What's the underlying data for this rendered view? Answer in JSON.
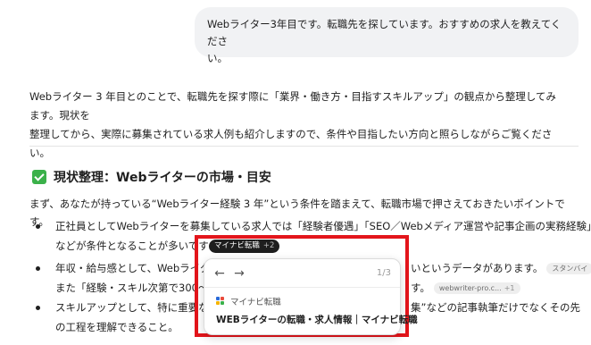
{
  "user_message": {
    "line1": "Webライター3年目です。転職先を探しています。おすすめの求人を教えてくださ",
    "line2": "い。"
  },
  "intro": {
    "line1": "Webライター 3 年目とのことで、転職先を探す際に「業界・働き方・目指すスキルアップ」の観点から整理してみます。現状を",
    "line2": "整理してから、実際に募集されている求人例も紹介しますので、条件や目指したい方向と照らしながらご覧ください。"
  },
  "section": {
    "heading": "現状整理：Webライターの市場・目安",
    "icon": "check-mark-button-icon",
    "icon_color": "#3bb14a",
    "lead": "まず、あなたが持っている“Webライター経験 3 年”という条件を踏まえて、転職市場で押さえておきたいポイントです。"
  },
  "bullets": [
    {
      "line1": "正社員としてWebライターを募集している求人では「経験者優遇」「SEO／Webメディア運営や記事企画の実務経験」",
      "line2": "などが条件となることが多いです"
    },
    {
      "line1a": "年収・給与感として、Webライター",
      "line1b": "いというデータがあります。",
      "chip1": "スタンバイ",
      "line2a": "また「経験・スキル次第で300～40",
      "line2b": "す。",
      "chip2": "webwriter-pro.c...",
      "chip2_count": "+1"
    },
    {
      "line1a": "スキルアップとして、特に重要な",
      "line1b": "集”などの記事執筆だけでなくその先",
      "line2": "の工程を理解できること。"
    }
  ],
  "citation_chip": {
    "label": "マイナビ転職",
    "count": "+2"
  },
  "popover": {
    "back": "←",
    "forward": "→",
    "pager": "1/3",
    "source_name": "マイナビ転職",
    "title": "WEBライターの転職・求人情報｜マイナビ転職"
  },
  "colors": {
    "highlight": "#e3151b",
    "chip_bg": "#1e1e1e",
    "bubble_bg": "#f1f2f4"
  }
}
